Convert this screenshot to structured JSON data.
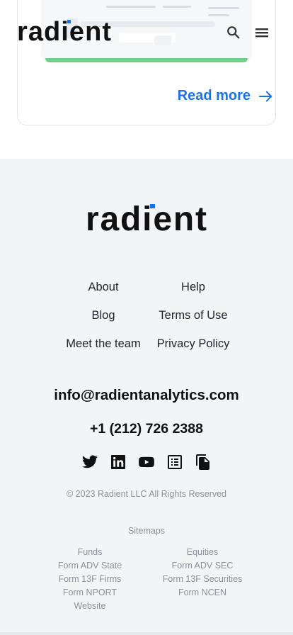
{
  "header": {
    "logo_text": "radient",
    "search_icon": "search-icon",
    "menu_icon": "menu-icon"
  },
  "card": {
    "read_more_label": "Read more",
    "arrow_icon": "arrow-right-icon"
  },
  "footer": {
    "logo_text": "radient",
    "links": {
      "about": "About",
      "help": "Help",
      "blog": "Blog",
      "terms": "Terms of Use",
      "team": "Meet the team",
      "privacy": "Privacy Policy"
    },
    "email": "info@radientanalytics.com",
    "phone": "+1 (212) 726 2388",
    "socials": [
      "twitter-icon",
      "linkedin-icon",
      "youtube-icon",
      "list-icon",
      "documents-icon"
    ],
    "copyright": "© 2023 Radient LLC  All Rights Reserved",
    "sitemaps_label": "Sitemaps",
    "sitemap_left": [
      "Funds",
      "Form ADV State",
      "Form 13F Firms",
      "Form NPORT",
      "Website"
    ],
    "sitemap_right": [
      "Equities",
      "Form ADV SEC",
      "Form 13F Securities",
      "Form NCEN"
    ]
  },
  "colors": {
    "accent": "#1a73e8",
    "footer_bg": "#f3f4f6",
    "text_dark": "#111111",
    "muted": "#8c9097"
  }
}
